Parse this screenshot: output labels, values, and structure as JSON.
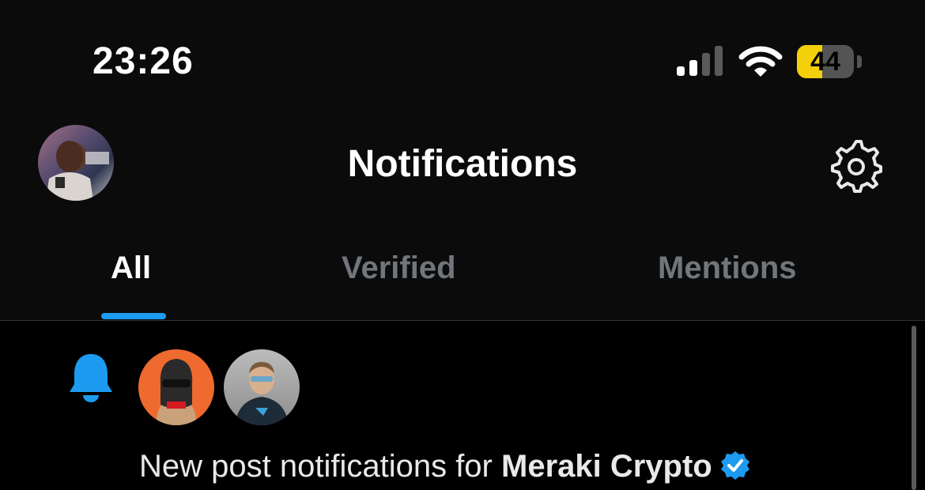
{
  "status_bar": {
    "time": "23:26",
    "battery_level": "44",
    "battery_fraction": 0.44,
    "signal_icon": "cellular-signal-icon",
    "wifi_icon": "wifi-icon"
  },
  "header": {
    "title": "Notifications",
    "settings_icon": "gear-icon"
  },
  "tabs": [
    {
      "label": "All",
      "active": true
    },
    {
      "label": "Verified",
      "active": false
    },
    {
      "label": "Mentions",
      "active": false
    }
  ],
  "notification": {
    "icon": "bell-icon",
    "text_prefix": "New post notifications for ",
    "account_name": "Meraki Crypto",
    "verified_badge_icon": "verified-badge-icon"
  },
  "colors": {
    "accent": "#1d9bf0",
    "battery_yellow": "#f4cf0b",
    "muted_text": "#71767b"
  }
}
